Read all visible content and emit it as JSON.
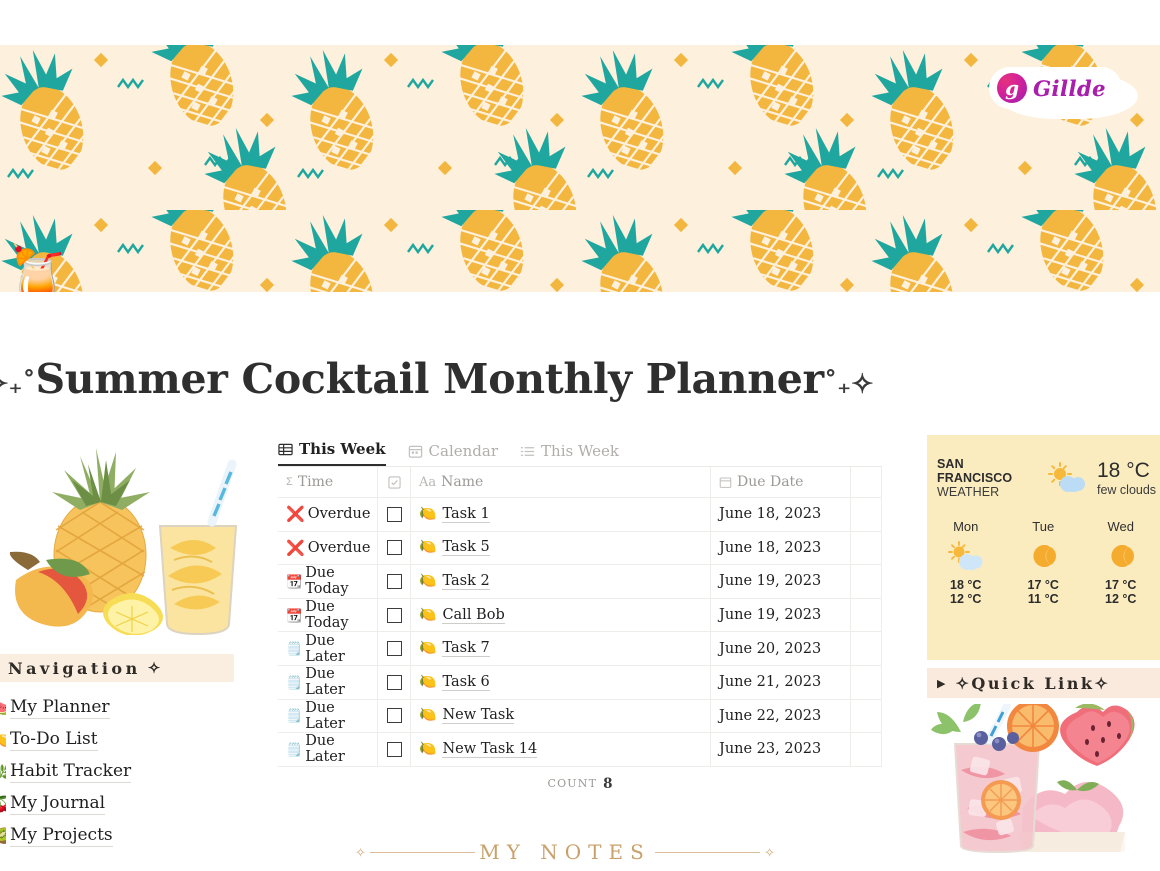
{
  "brand": {
    "name": "Gillde",
    "mark_letter": "g",
    "mark_gradient_from": "#e5327f",
    "mark_gradient_to": "#9b1fb0"
  },
  "banner": {
    "background_color": "#fdf0dc",
    "pineapple_color": "#f3b63e",
    "leaf_color": "#1fa79f",
    "cocktail_icon": "🍹"
  },
  "page_title": {
    "prefix_deco": "✧₊˚",
    "text": "Summer Cocktail Monthly Planner",
    "suffix_deco": "˚₊✧"
  },
  "left": {
    "illustration_name": "pineapple-mango-lemon-cocktail-watercolor",
    "navigation": {
      "header": "Navigation",
      "header_deco": "✧",
      "items": [
        {
          "emoji": "🍉",
          "label": "My Planner"
        },
        {
          "emoji": "🍋",
          "label": "To-Do List"
        },
        {
          "emoji": "🌿",
          "label": "Habit Tracker"
        },
        {
          "emoji": "🍒",
          "label": "My Journal"
        },
        {
          "emoji": "🥝",
          "label": "My Projects"
        }
      ]
    }
  },
  "database": {
    "tabs": [
      {
        "label": "This Week",
        "icon": "table-icon",
        "active": true
      },
      {
        "label": "Calendar",
        "icon": "calendar-icon",
        "active": false
      },
      {
        "label": "This Week",
        "icon": "list-icon",
        "active": false
      }
    ],
    "columns": [
      {
        "key": "time",
        "label": "Time",
        "icon": "sigma-icon"
      },
      {
        "key": "check",
        "label": "",
        "icon": "checkbox-icon"
      },
      {
        "key": "name",
        "label": "Name",
        "icon": "text-icon"
      },
      {
        "key": "date",
        "label": "Due Date",
        "icon": "calendar-icon"
      }
    ],
    "rows": [
      {
        "status_icon": "❌",
        "status": "Overdue",
        "checked": false,
        "emoji": "🍋",
        "name": "Task 1",
        "date": "June 18, 2023"
      },
      {
        "status_icon": "❌",
        "status": "Overdue",
        "checked": false,
        "emoji": "🍋",
        "name": "Task 5",
        "date": "June 18, 2023"
      },
      {
        "status_icon": "📆",
        "status": "Due Today",
        "checked": false,
        "emoji": "🍋",
        "name": "Task 2",
        "date": "June 19, 2023"
      },
      {
        "status_icon": "📆",
        "status": "Due Today",
        "checked": false,
        "emoji": "🍋",
        "name": "Call Bob",
        "date": "June 19, 2023"
      },
      {
        "status_icon": "🗒️",
        "status": "Due Later",
        "checked": false,
        "emoji": "🍋",
        "name": "Task 7",
        "date": "June 20, 2023"
      },
      {
        "status_icon": "🗒️",
        "status": "Due Later",
        "checked": false,
        "emoji": "🍋",
        "name": "Task 6",
        "date": "June 21, 2023"
      },
      {
        "status_icon": "🗒️",
        "status": "Due Later",
        "checked": false,
        "emoji": "🍋",
        "name": "New Task",
        "date": "June 22, 2023"
      },
      {
        "status_icon": "🗒️",
        "status": "Due Later",
        "checked": false,
        "emoji": "🍋",
        "name": "New Task 14",
        "date": "June 23, 2023"
      }
    ],
    "count_label": "Count",
    "count_value": "8"
  },
  "notes_divider": {
    "text": "MY NOTES",
    "diamond": "✧",
    "color": "#c8a06a"
  },
  "right": {
    "weather": {
      "city": "SAN FRANCISCO",
      "subtitle": "WEATHER",
      "current_icon": "sun-cloud-icon",
      "current_temp": "18 °C",
      "current_desc": "few clouds",
      "background_color": "#fbecc0",
      "forecast": [
        {
          "day": "Mon",
          "icon": "sun-cloud-icon",
          "high": "18 °C",
          "low": "12 °C"
        },
        {
          "day": "Tue",
          "icon": "moon-icon",
          "high": "17 °C",
          "low": "11 °C"
        },
        {
          "day": "Wed",
          "icon": "moon-icon",
          "high": "17 °C",
          "low": "12 °C"
        }
      ]
    },
    "quick_link": {
      "caret": "▶",
      "deco_left": "✧",
      "text": "Quick Link",
      "deco_right": "✧"
    },
    "illustration_name": "pink-sangria-watermelon-icecream-watercolor"
  }
}
